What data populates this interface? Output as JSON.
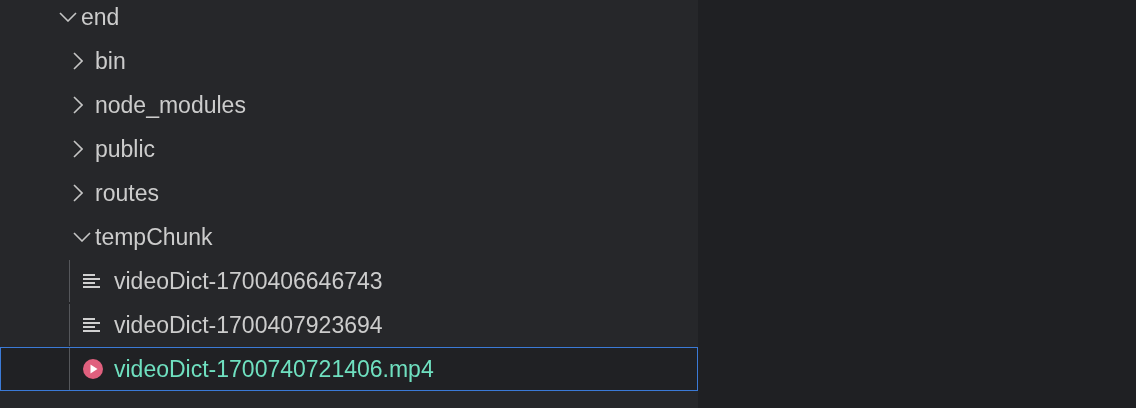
{
  "tree": [
    {
      "label": "end",
      "kind": "folder",
      "expanded": true,
      "selected": false,
      "children": [
        {
          "label": "bin",
          "kind": "folder",
          "expanded": false,
          "selected": false
        },
        {
          "label": "node_modules",
          "kind": "folder",
          "expanded": false,
          "selected": false
        },
        {
          "label": "public",
          "kind": "folder",
          "expanded": false,
          "selected": false
        },
        {
          "label": "routes",
          "kind": "folder",
          "expanded": false,
          "selected": false
        },
        {
          "label": "tempChunk",
          "kind": "folder",
          "expanded": true,
          "selected": false,
          "children": [
            {
              "label": "videoDict-1700406646743",
              "kind": "text",
              "selected": false,
              "color": "#cccccc"
            },
            {
              "label": "videoDict-1700407923694",
              "kind": "text",
              "selected": false,
              "color": "#cccccc"
            },
            {
              "label": "videoDict-1700740721406.mp4",
              "kind": "video",
              "selected": true,
              "color": "#6fe0c0"
            }
          ]
        }
      ]
    }
  ]
}
